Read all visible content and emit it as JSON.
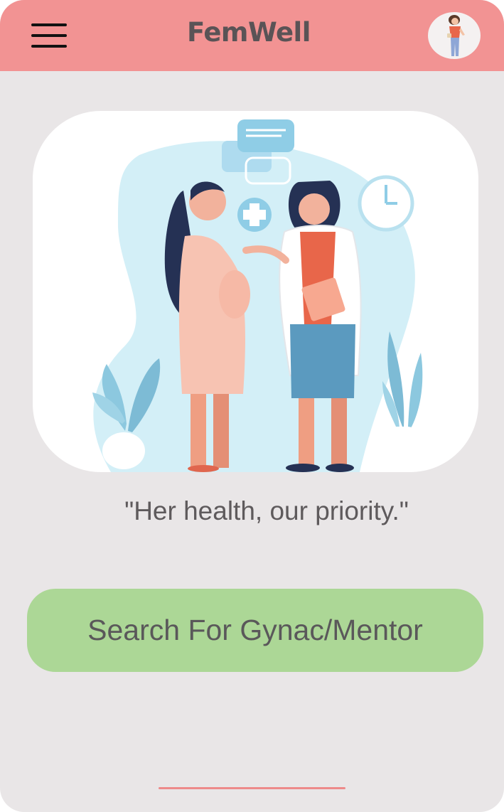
{
  "app": {
    "brand_name": "FemWell"
  },
  "header": {
    "menu_icon": "hamburger-menu-icon",
    "avatar_icon": "user-avatar-icon"
  },
  "hero": {
    "illustration": "pregnant-woman-consulting-doctor-illustration"
  },
  "tagline": "\"Her health, our priority.\"",
  "search_button": {
    "label": "Search For Gynac/Mentor"
  },
  "colors": {
    "header": "#f29393",
    "background": "#e9e6e7",
    "button": "#acd796",
    "home_indicator": "#ee8a8a"
  }
}
